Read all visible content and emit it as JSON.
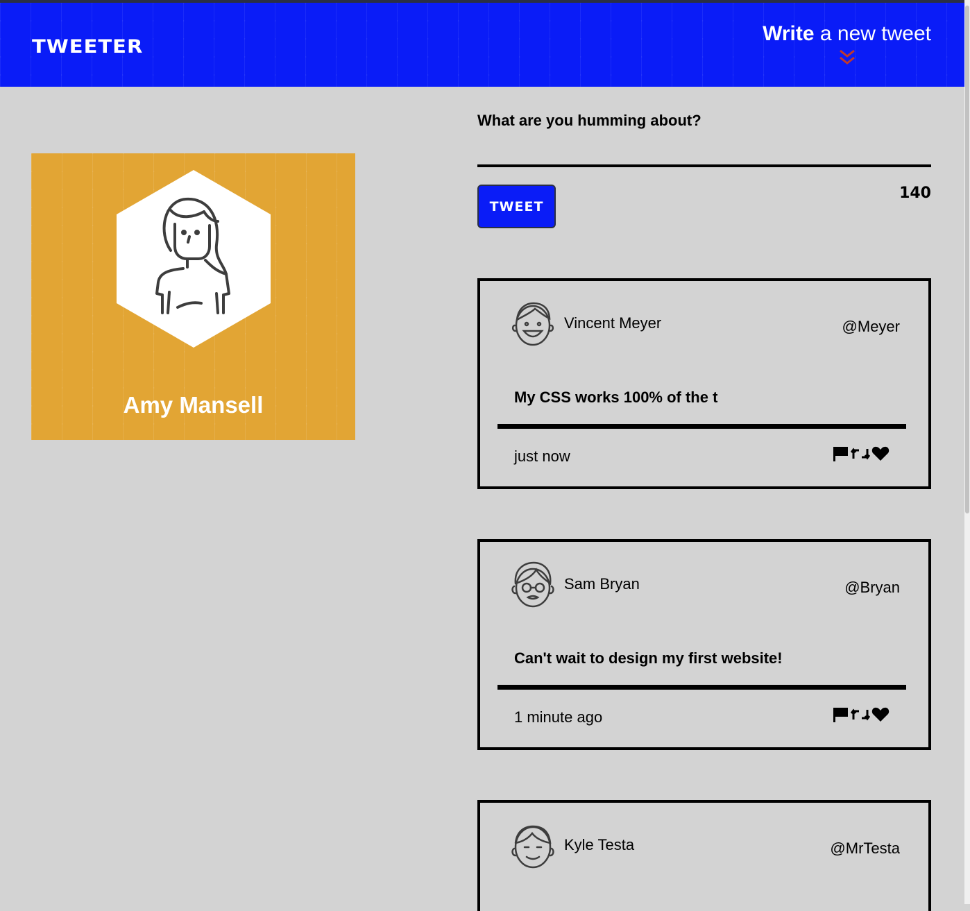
{
  "header": {
    "brand": "TWEETER",
    "compose_strong": "Write",
    "compose_rest": " a new tweet",
    "toggle_icon": "double-chevron-down-icon",
    "toggle_color": "#c0392b",
    "bar_color": "#0a1cf7"
  },
  "profile": {
    "name": "Amy Mansell",
    "avatar_icon": "woman-avatar-icon",
    "card_color": "#e2a534"
  },
  "compose": {
    "label": "What are you humming about?",
    "input_value": "",
    "button_label": "TWEET",
    "counter": "140"
  },
  "tweets": [
    {
      "author": "Vincent Meyer",
      "handle": "@Meyer",
      "body": "My CSS works 100% of the t",
      "time": "just now",
      "avatar_icon": "smiling-man-avatar-icon"
    },
    {
      "author": "Sam Bryan",
      "handle": "@Bryan",
      "body": "Can't wait to design my first website!",
      "time": "1 minute ago",
      "avatar_icon": "glasses-man-avatar-icon"
    },
    {
      "author": "Kyle Testa",
      "handle": "@MrTesta",
      "body": "",
      "time": "",
      "avatar_icon": "man-avatar-icon"
    }
  ],
  "actions": [
    "flag-icon",
    "retweet-icon",
    "heart-icon"
  ]
}
